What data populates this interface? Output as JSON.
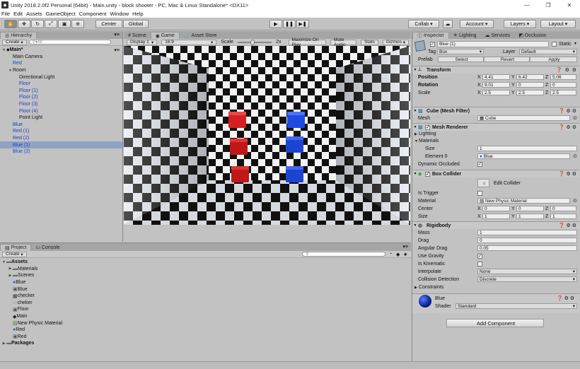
{
  "window": {
    "title": "Unity 2018.2.0f2 Personal (64bit) - Main.unity - block shooter - PC, Mac & Linux Standalone* <DX11>"
  },
  "menu": [
    "File",
    "Edit",
    "Assets",
    "GameObject",
    "Component",
    "Window",
    "Help"
  ],
  "toolbar": {
    "center": "Center",
    "global": "Global",
    "collab": "Collab",
    "account": "Account",
    "layers": "Layers",
    "layout": "Layout"
  },
  "hierarchy": {
    "tab": "Hierarchy",
    "create": "Create",
    "search_placeholder": "All",
    "items": [
      {
        "label": "Main*",
        "bold": true,
        "arrow": "▼",
        "indent": 0
      },
      {
        "label": "Main Camera",
        "indent": 1
      },
      {
        "label": "Red",
        "indent": 1,
        "blue": true
      },
      {
        "label": "Room",
        "indent": 1,
        "arrow": "▼"
      },
      {
        "label": "Directional Light",
        "indent": 2
      },
      {
        "label": "Floor",
        "indent": 2,
        "blue": true
      },
      {
        "label": "Floor (1)",
        "indent": 2,
        "blue": true
      },
      {
        "label": "Floor (2)",
        "indent": 2,
        "blue": true
      },
      {
        "label": "Floor (3)",
        "indent": 2,
        "blue": true
      },
      {
        "label": "Floor (4)",
        "indent": 2,
        "blue": true
      },
      {
        "label": "Point Light",
        "indent": 2
      },
      {
        "label": "Blue",
        "indent": 1,
        "blue": true
      },
      {
        "label": "Red (1)",
        "indent": 1,
        "blue": true
      },
      {
        "label": "Red (2)",
        "indent": 1,
        "blue": true
      },
      {
        "label": "Blue (1)",
        "indent": 1,
        "blue": true,
        "selected": true
      },
      {
        "label": "Blue (2)",
        "indent": 1,
        "blue": true
      }
    ]
  },
  "scene_tabs": {
    "scene": "Scene",
    "game": "Game",
    "asset_store": "Asset Store"
  },
  "game_bar": {
    "display": "Display 1",
    "aspect": "16:9",
    "scale_label": "Scale",
    "scale_value": "2x",
    "maximize": "Maximize On Play",
    "mute": "Mute Audio",
    "stats": "Stats",
    "gizmos": "Gizmos"
  },
  "project": {
    "tab": "Project",
    "console_tab": "Console",
    "create": "Create",
    "items": [
      {
        "label": "Assets",
        "bold": true,
        "arrow": "▼",
        "indent": 0,
        "icon": "folder"
      },
      {
        "label": "Materials",
        "arrow": "▶",
        "indent": 1,
        "icon": "folder"
      },
      {
        "label": "Scenes",
        "arrow": "▶",
        "indent": 1,
        "icon": "folder"
      },
      {
        "label": "Blue",
        "indent": 1,
        "icon": "sphere"
      },
      {
        "label": "Blue",
        "indent": 1,
        "icon": "cube"
      },
      {
        "label": "checker",
        "indent": 1,
        "icon": "checker"
      },
      {
        "label": "cheker",
        "indent": 1,
        "icon": "blank"
      },
      {
        "label": "Floor",
        "indent": 1,
        "icon": "cube"
      },
      {
        "label": "Main",
        "indent": 1,
        "icon": "unity"
      },
      {
        "label": "New Physic Material",
        "indent": 1,
        "icon": "phys"
      },
      {
        "label": "Red",
        "indent": 1,
        "icon": "sphere"
      },
      {
        "label": "Red",
        "indent": 1,
        "icon": "cube"
      },
      {
        "label": "Packages",
        "bold": true,
        "arrow": "▶",
        "indent": 0,
        "icon": "folder"
      }
    ]
  },
  "inspector": {
    "tab": "Inspector",
    "lighting_tab": "Lighting",
    "services_tab": "Services",
    "occlusion_tab": "Occlusion",
    "object_name": "Blue (1)",
    "static": "Static",
    "tag_label": "Tag",
    "tag": "Box",
    "layer_label": "Layer",
    "layer": "Default",
    "prefab_label": "Prefab",
    "prefab_select": "Select",
    "prefab_revert": "Revert",
    "prefab_apply": "Apply",
    "transform": {
      "title": "Transform",
      "position": "Position",
      "rotation": "Rotation",
      "scale": "Scale",
      "pos": [
        "4.41",
        "6.42",
        "5.06"
      ],
      "rot": [
        "9.01",
        "0",
        "0"
      ],
      "scl": [
        "2.5",
        "2.5",
        "2.5"
      ]
    },
    "mesh_filter": {
      "title": "Cube (Mesh Filter)",
      "mesh_label": "Mesh",
      "mesh": "Cube"
    },
    "mesh_renderer": {
      "title": "Mesh Renderer",
      "lighting": "Lighting",
      "materials": "Materials",
      "size_label": "Size",
      "size": "1",
      "element_label": "Element 0",
      "element": "Blue",
      "dynamic_occluded": "Dynamic Occluded"
    },
    "box_collider": {
      "title": "Box Collider",
      "edit": "Edit Collider",
      "is_trigger": "Is Trigger",
      "material_label": "Material",
      "material": "New Physic Material",
      "center_label": "Center",
      "center": [
        "0",
        "0",
        "0"
      ],
      "size_label": "Size",
      "size": [
        "1",
        "1",
        "1"
      ]
    },
    "rigidbody": {
      "title": "Rigidbody",
      "mass_label": "Mass",
      "mass": "1",
      "drag_label": "Drag",
      "drag": "0",
      "ang_label": "Angular Drag",
      "ang": "0.05",
      "gravity": "Use Gravity",
      "kinematic": "Is Kinematic",
      "interp_label": "Interpolate",
      "interp": "None",
      "coll_label": "Collision Detection",
      "coll": "Discrete",
      "constraints": "Constraints"
    },
    "material": {
      "name": "Blue",
      "shader_label": "Shader",
      "shader": "Standard"
    },
    "add_component": "Add Component"
  },
  "colors": {
    "red_cube": "#d42020",
    "blue_cube": "#1f4be0",
    "selection": "#8fa3c4"
  }
}
